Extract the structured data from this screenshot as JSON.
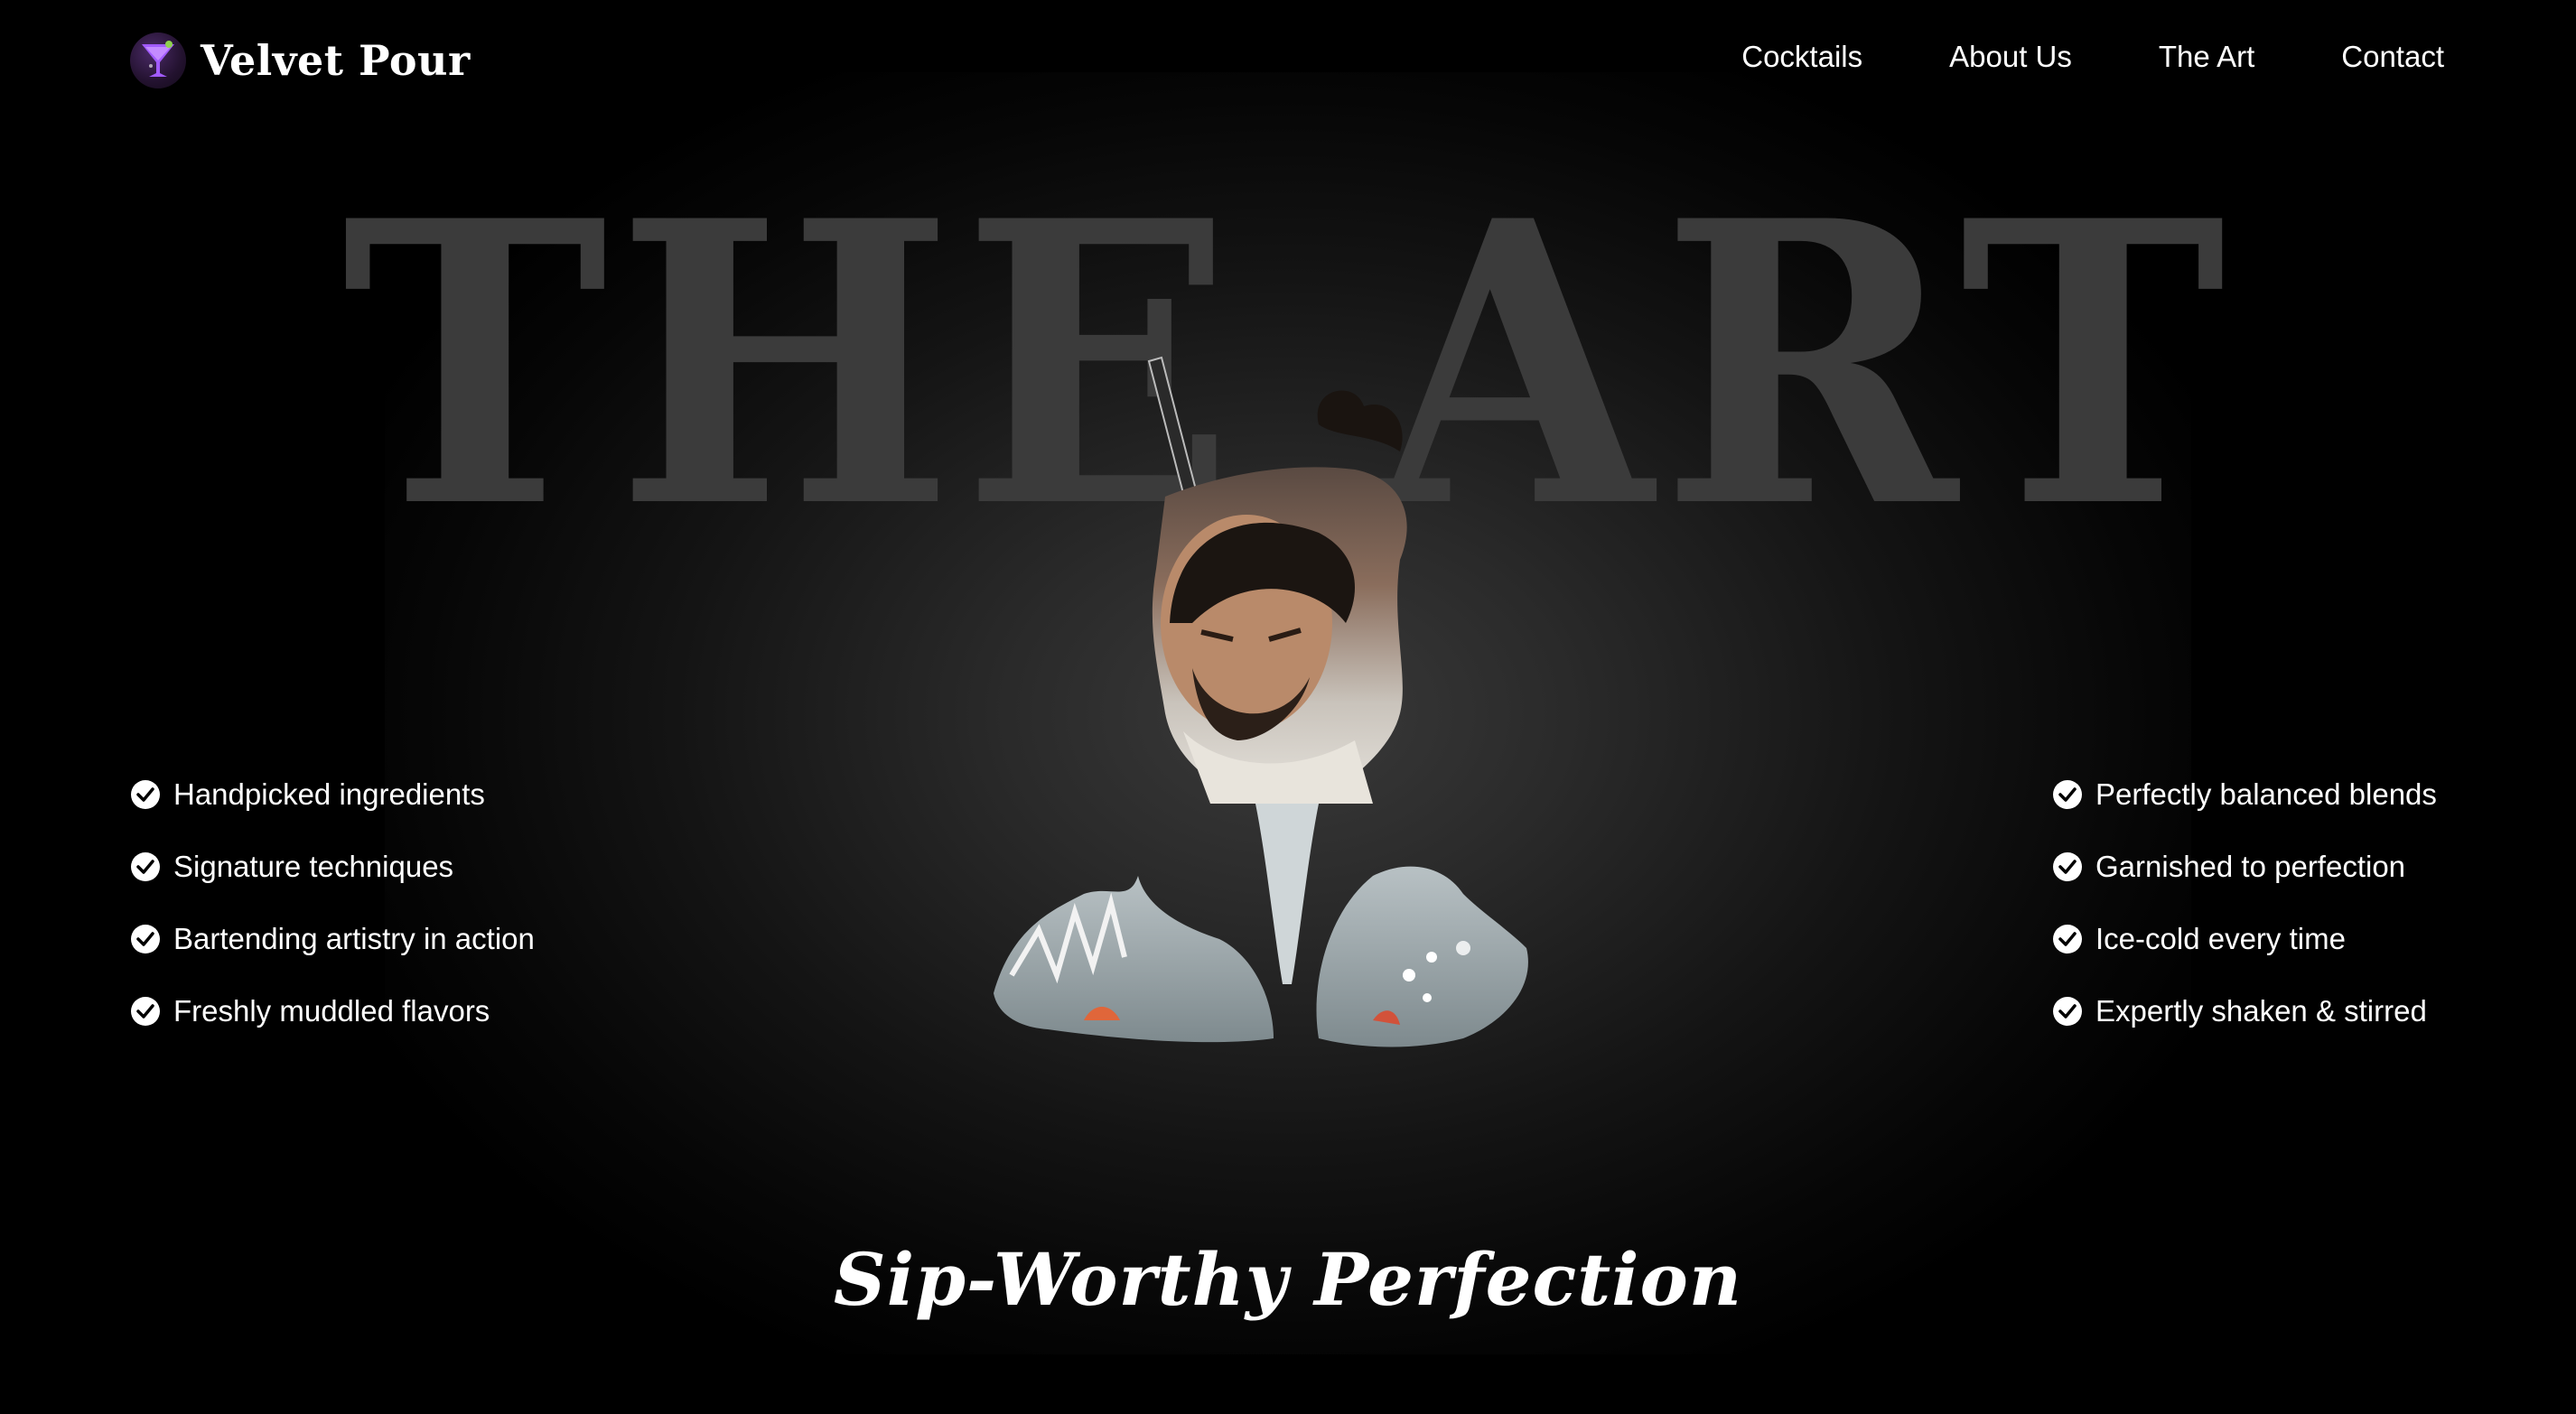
{
  "brand": {
    "name": "Velvet Pour",
    "logo_icon": "cocktail-glass-icon"
  },
  "nav": {
    "items": [
      {
        "label": "Cocktails"
      },
      {
        "label": "About Us"
      },
      {
        "label": "The Art"
      },
      {
        "label": "Contact"
      }
    ]
  },
  "hero": {
    "title": "THE ART",
    "image_description": "bartender-in-cocktail-glass-silhouette"
  },
  "features_left": [
    {
      "label": "Handpicked ingredients",
      "icon": "check-circle-icon"
    },
    {
      "label": "Signature techniques",
      "icon": "check-circle-icon"
    },
    {
      "label": "Bartending artistry in action",
      "icon": "check-circle-icon"
    },
    {
      "label": "Freshly muddled flavors",
      "icon": "check-circle-icon"
    }
  ],
  "features_right": [
    {
      "label": "Perfectly balanced blends",
      "icon": "check-circle-icon"
    },
    {
      "label": "Garnished to perfection",
      "icon": "check-circle-icon"
    },
    {
      "label": "Ice-cold every time",
      "icon": "check-circle-icon"
    },
    {
      "label": "Expertly shaken & stirred",
      "icon": "check-circle-icon"
    }
  ],
  "headline": "Sip-Worthy Perfection",
  "colors": {
    "background": "#000000",
    "title_ghost": "#3b3b3b",
    "text": "#ffffff",
    "logo_accent": "#9b4dff"
  }
}
